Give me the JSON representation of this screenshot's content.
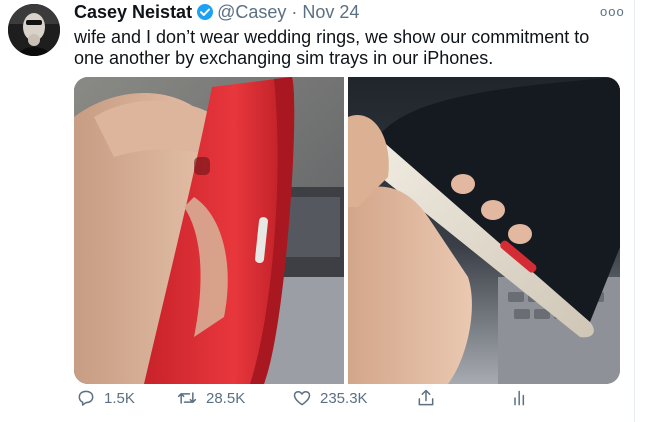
{
  "tweet": {
    "author_name": "Casey Neistat",
    "handle": "@Casey",
    "separator": "·",
    "date": "Nov 24",
    "more_label": "ooo",
    "text": "wife and I don’t wear wedding rings, we show our commitment to one another by exchanging sim trays in our iPhones.",
    "icons": {
      "verified": "verified-badge-icon",
      "more": "more-options-icon"
    }
  },
  "media": {
    "images": [
      {
        "name": "red-iphone-photo",
        "colors": {
          "phone": "#e8373d",
          "sim_tray": "#e7e7e4"
        }
      },
      {
        "name": "white-iphone-photo",
        "colors": {
          "phone": "#e7e0d3",
          "sim_tray": "#d42c35"
        }
      }
    ]
  },
  "actions": {
    "reply": {
      "icon": "reply-icon",
      "count": "1.5K"
    },
    "retweet": {
      "icon": "retweet-icon",
      "count": "28.5K"
    },
    "like": {
      "icon": "like-icon",
      "count": "235.3K"
    },
    "share": {
      "icon": "share-icon"
    },
    "analytics": {
      "icon": "analytics-icon"
    }
  },
  "colors": {
    "verified_blue": "#1da1f2",
    "secondary_text": "#5b7083"
  }
}
